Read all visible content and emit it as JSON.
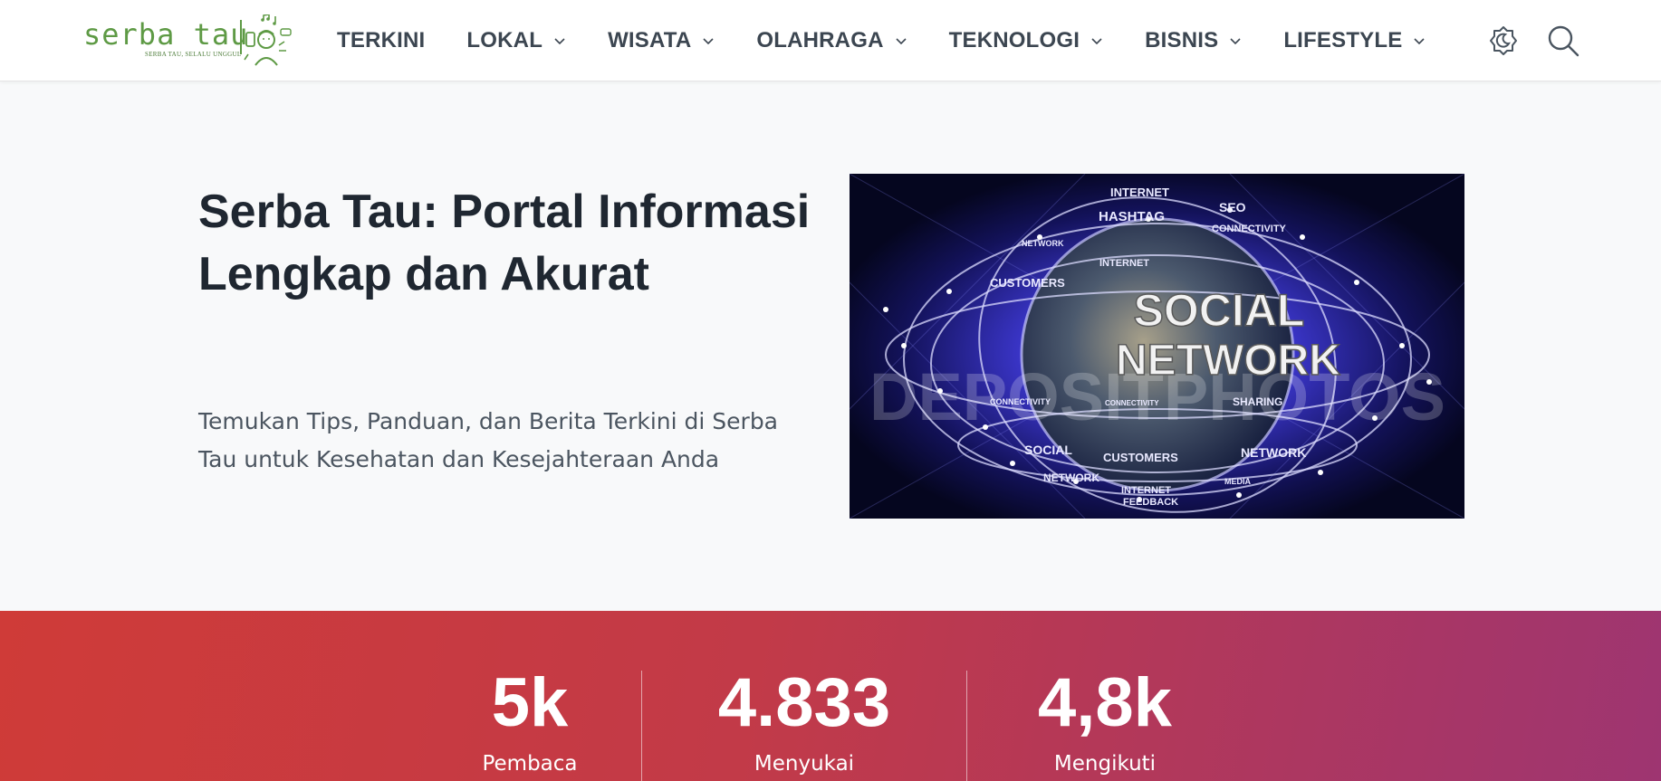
{
  "brand": {
    "name": "serba tau",
    "tagline": "SERBA TAU, SELALU UNGGUL",
    "color": "#5e9a45"
  },
  "nav": {
    "items": [
      {
        "label": "TERKINI",
        "has_dropdown": false
      },
      {
        "label": "LOKAL",
        "has_dropdown": true
      },
      {
        "label": "WISATA",
        "has_dropdown": true
      },
      {
        "label": "OLAHRAGA",
        "has_dropdown": true
      },
      {
        "label": "TEKNOLOGI",
        "has_dropdown": true
      },
      {
        "label": "BISNIS",
        "has_dropdown": true
      },
      {
        "label": "LIFESTYLE",
        "has_dropdown": true
      }
    ]
  },
  "header_icons": {
    "theme": "theme-toggle-icon",
    "search": "search-icon"
  },
  "hero": {
    "title": "Serba Tau: Portal Informasi Lengkap dan Akurat",
    "subtitle": "Temukan Tips, Panduan, dan Berita Terkini di Serba Tau untuk Kesehatan dan Kesejahteraan Anda",
    "image_words": {
      "main_top": "SOCIAL",
      "main_bottom": "NETWORK",
      "watermark": "DEPOSITPHOTOS",
      "tags": [
        "INTERNET",
        "HASHTAG",
        "SEO",
        "CONNECTIVITY",
        "NETWORK",
        "INTERNET",
        "CUSTOMERS",
        "CONNECTIVITY",
        "SHARING",
        "SOCIAL",
        "CUSTOMERS",
        "NETWORK",
        "NETWORK",
        "INTERNET",
        "FEEDBACK",
        "MEDIA",
        "CONNECTIVITY"
      ]
    }
  },
  "stats": [
    {
      "value": "5k",
      "label": "Pembaca"
    },
    {
      "value": "4.833",
      "label": "Menyukai"
    },
    {
      "value": "4,8k",
      "label": "Mengikuti"
    }
  ],
  "colors": {
    "header_bg": "#ffffff",
    "page_bg": "#f8f9fa",
    "title": "#1f2731",
    "nav_text": "#3c4651",
    "band_start": "#cf3b38",
    "band_end": "#9e3571"
  }
}
